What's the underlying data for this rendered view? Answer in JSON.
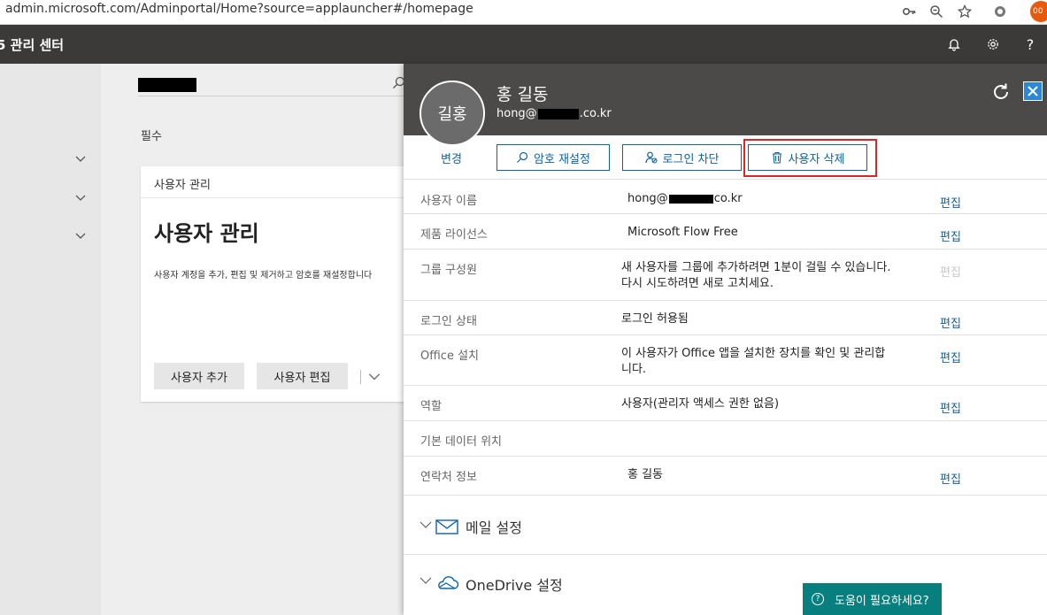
{
  "browser": {
    "url": "admin.microsoft.com/Adminportal/Home?source=applauncher#/homepage",
    "profile_badge": "00"
  },
  "app": {
    "title": "5 관리 센터"
  },
  "main": {
    "section_label": "필수",
    "card": {
      "header": "사용자 관리",
      "title": "사용자 관리",
      "description": "사용자 계정을 추가, 편집 및 제거하고 암호를 재설정합니다",
      "add_user_label": "사용자 추가",
      "edit_user_label": "사용자 편집"
    }
  },
  "panel": {
    "avatar_initials": "길홍",
    "user_name": "홍 길동",
    "email_prefix": "hong@",
    "email_suffix": ".co.kr",
    "actions": {
      "change": "변경",
      "reset_password": "암호 재설정",
      "block_login": "로그인 차단",
      "delete_user": "사용자 삭제"
    },
    "edit_label": "편집",
    "rows": [
      {
        "label": "사용자 이름",
        "value_prefix": "hong@",
        "value_suffix": "co.kr"
      },
      {
        "label": "제품 라이선스",
        "value": "Microsoft Flow Free"
      },
      {
        "label": "그룹 구성원",
        "value": "새 사용자를 그룹에 추가하려면 1분이 걸릴 수 있습니다. 다시 시도하려면 새로 고치세요."
      },
      {
        "label": "로그인 상태",
        "value": "로그인 허용됨"
      },
      {
        "label": "Office 설치",
        "value": "이 사용자가 Office 앱을 설치한 장치를 확인 및 관리합니다."
      },
      {
        "label": "역할",
        "value": "사용자(관리자 액세스 권한 없음)"
      },
      {
        "label": "기본 데이터 위치",
        "value": ""
      },
      {
        "label": "연락처 정보",
        "value": "홍 길동"
      }
    ],
    "sections": {
      "mail": "메일 설정",
      "onedrive": "OneDrive 설정"
    }
  },
  "help": {
    "label": "도움이 필요하세요?"
  },
  "colors": {
    "header_bg": "#3b3a39",
    "panel_header_bg": "#4b4a48",
    "link_blue": "#0b62a8",
    "highlight_red": "#d9262a",
    "help_teal": "#087f7f",
    "profile_orange": "#e8590c"
  }
}
